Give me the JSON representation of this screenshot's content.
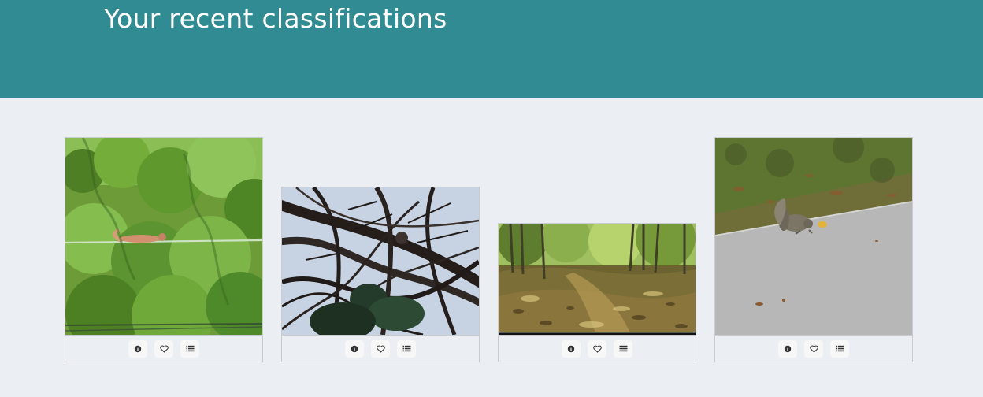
{
  "header": {
    "title": "Your recent classifications"
  },
  "theme": {
    "header_bg": "#318b93",
    "page_bg": "#ebeef2",
    "card_border": "#c9cbce"
  },
  "cards": [
    {
      "image_subject": "squirrel-on-wire-in-green-trees",
      "actions": [
        "info-icon",
        "favorite-heart-icon",
        "collections-list-icon"
      ]
    },
    {
      "image_subject": "squirrel-in-bare-branches",
      "actions": [
        "info-icon",
        "favorite-heart-icon",
        "collections-list-icon"
      ]
    },
    {
      "image_subject": "forest-floor-trail-camera",
      "actions": [
        "info-icon",
        "favorite-heart-icon",
        "collections-list-icon"
      ]
    },
    {
      "image_subject": "squirrel-on-pavement-near-grass",
      "actions": [
        "info-icon",
        "favorite-heart-icon",
        "collections-list-icon"
      ]
    }
  ]
}
